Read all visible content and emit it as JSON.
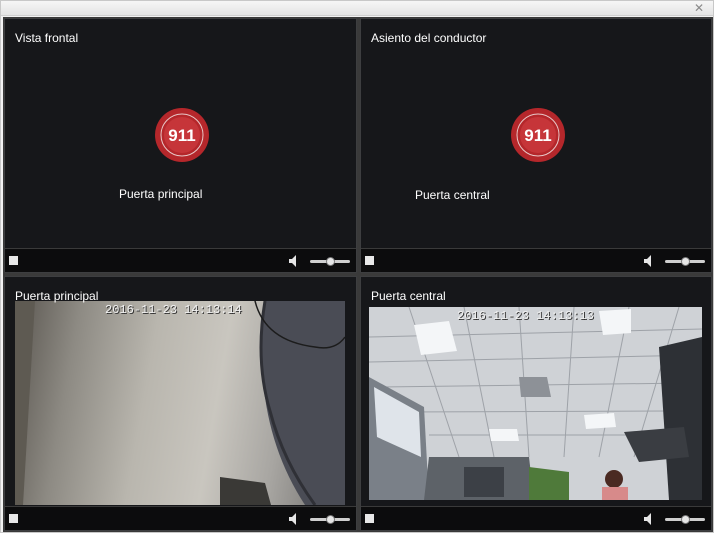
{
  "window": {
    "close_icon": "close-icon"
  },
  "panes": [
    {
      "label": "Vista frontal",
      "center_text": "Puerta principal",
      "status": "no-signal",
      "logo_text": "911"
    },
    {
      "label": "Asiento del conductor",
      "center_text": "Puerta central",
      "status": "no-signal",
      "logo_text": "911"
    },
    {
      "label": "Puerta principal",
      "timestamp": "2016-11-23  14:13:14",
      "status": "live"
    },
    {
      "label": "Puerta central",
      "timestamp": "2016-11-23  14:13:13",
      "status": "live"
    }
  ],
  "controls": {
    "stop_icon": "stop-icon",
    "volume_icon": "speaker-icon",
    "volume_level": 0.5
  },
  "colors": {
    "pane_bg": "#1b1c1e",
    "controls_bg": "#0c0c0d",
    "logo_red": "#b5272b"
  }
}
